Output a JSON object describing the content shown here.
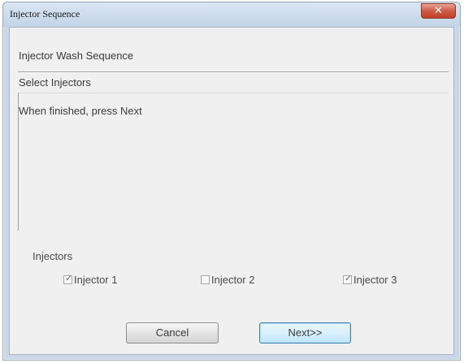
{
  "window": {
    "title": "Injector Sequence",
    "close_glyph": "✕"
  },
  "content": {
    "wash_label": "Injector Wash Sequence",
    "select_label": "Select Injectors",
    "instruction": "When finished, press Next"
  },
  "injectors": {
    "group_label": "Injectors",
    "items": [
      {
        "label": "Injector 1",
        "checked": true
      },
      {
        "label": "Injector 2",
        "checked": false
      },
      {
        "label": "Injector 3",
        "checked": true
      }
    ]
  },
  "buttons": {
    "cancel_label": "Cancel",
    "next_label": "Next>>"
  },
  "colors": {
    "close_button": "#c94a33",
    "default_button_border": "#3c7fb1",
    "titlebar": "#c9d7e6"
  }
}
